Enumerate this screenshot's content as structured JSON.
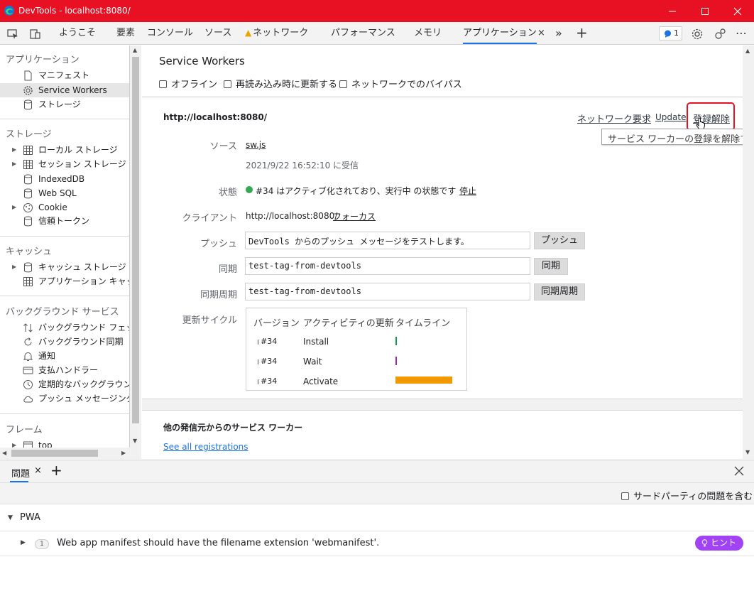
{
  "window": {
    "title": "DevTools - localhost:8080/"
  },
  "tabs": [
    {
      "label": "ようこそ"
    },
    {
      "label": "要素"
    },
    {
      "label": "コンソール"
    },
    {
      "label": "ソース"
    },
    {
      "label": "ネットワーク",
      "warning": true
    },
    {
      "label": "パフォーマンス"
    },
    {
      "label": "メモリ"
    },
    {
      "label": "アプリケーション",
      "active": true
    }
  ],
  "issues_badge": "1",
  "sidebar": {
    "sections": [
      {
        "title": "アプリケーション",
        "items": [
          {
            "label": "マニフェスト",
            "icon": "file-icon"
          },
          {
            "label": "Service Workers",
            "icon": "gear-icon",
            "selected": true
          },
          {
            "label": "ストレージ",
            "icon": "database-icon"
          }
        ]
      },
      {
        "title": "ストレージ",
        "items": [
          {
            "label": "ローカル ストレージ",
            "icon": "grid-icon",
            "expandable": true
          },
          {
            "label": "セッション ストレージ",
            "icon": "grid-icon",
            "expandable": true
          },
          {
            "label": "IndexedDB",
            "icon": "database-icon"
          },
          {
            "label": "Web SQL",
            "icon": "database-icon"
          },
          {
            "label": "Cookie",
            "icon": "cookie-icon",
            "expandable": true
          },
          {
            "label": "信頼トークン",
            "icon": "database-icon"
          }
        ]
      },
      {
        "title": "キャッシュ",
        "items": [
          {
            "label": "キャッシュ ストレージ",
            "icon": "database-icon",
            "expandable": true
          },
          {
            "label": "アプリケーション キャッシュ",
            "icon": "grid-icon"
          }
        ]
      },
      {
        "title": "バックグラウンド サービス",
        "items": [
          {
            "label": "バックグラウンド フェッチ",
            "icon": "updown-icon"
          },
          {
            "label": "バックグラウンド同期",
            "icon": "sync-icon"
          },
          {
            "label": "通知",
            "icon": "bell-icon"
          },
          {
            "label": "支払ハンドラー",
            "icon": "card-icon"
          },
          {
            "label": "定期的なバックグラウンド同期",
            "icon": "clock-icon"
          },
          {
            "label": "プッシュ メッセージング",
            "icon": "cloud-icon"
          }
        ]
      },
      {
        "title": "フレーム",
        "items": [
          {
            "label": "top",
            "icon": "frame-icon",
            "expandable": true
          }
        ]
      }
    ]
  },
  "main": {
    "heading": "Service Workers",
    "options": [
      {
        "label": "オフライン"
      },
      {
        "label": "再読み込み時に更新する"
      },
      {
        "label": "ネットワークでのバイパス"
      }
    ],
    "origin": "http://localhost:8080/",
    "actions": {
      "network": "ネットワーク要求",
      "update": "Update",
      "unregister": "登録解除"
    },
    "tooltip": "サービス ワーカーの登録を解除する",
    "rows": {
      "source_label": "ソース",
      "source_link": "sw.js",
      "received": "2021/9/22 16:52:10 に受信",
      "status_label": "状態",
      "status_text": "#34 はアクティブ化されており、実行中 の状態です",
      "status_link": "停止",
      "status_color": "#34a853",
      "clients_label": "クライアント",
      "clients_value": "http://localhost:8080/",
      "clients_link": "フォーカス",
      "push_label": "プッシュ",
      "push_value": "DevTools からのプッシュ メッセージをテストします。",
      "push_button": "プッシュ",
      "sync_label": "同期",
      "sync_value": "test-tag-from-devtools",
      "sync_button": "同期",
      "psync_label": "同期周期",
      "psync_value": "test-tag-from-devtools",
      "psync_button": "同期周期",
      "cycle_label": "更新サイクル"
    },
    "cycle_table": {
      "headers": [
        "バージョン",
        "アクティビティの更新",
        "タイムライン"
      ],
      "rows": [
        {
          "version": "#34",
          "activity": "Install",
          "bar_fraction": 0.02,
          "color": "#0f9d58"
        },
        {
          "version": "#34",
          "activity": "Wait",
          "bar_fraction": 0.02,
          "color": "#9c27b0"
        },
        {
          "version": "#34",
          "activity": "Activate",
          "bar_fraction": 1.0,
          "color": "#f29900"
        }
      ]
    },
    "other_origins_heading": "他の発信元からのサービス ワーカー",
    "see_all": "See all registrations"
  },
  "drawer": {
    "tab": "問題",
    "third_party_label": "サードパーティの問題を含む",
    "group": "PWA",
    "issue_count": "1",
    "issue_text": "Web app manifest should have the filename extension 'webmanifest'.",
    "hint_label": "ヒント",
    "hint_color": "#a142f4"
  }
}
